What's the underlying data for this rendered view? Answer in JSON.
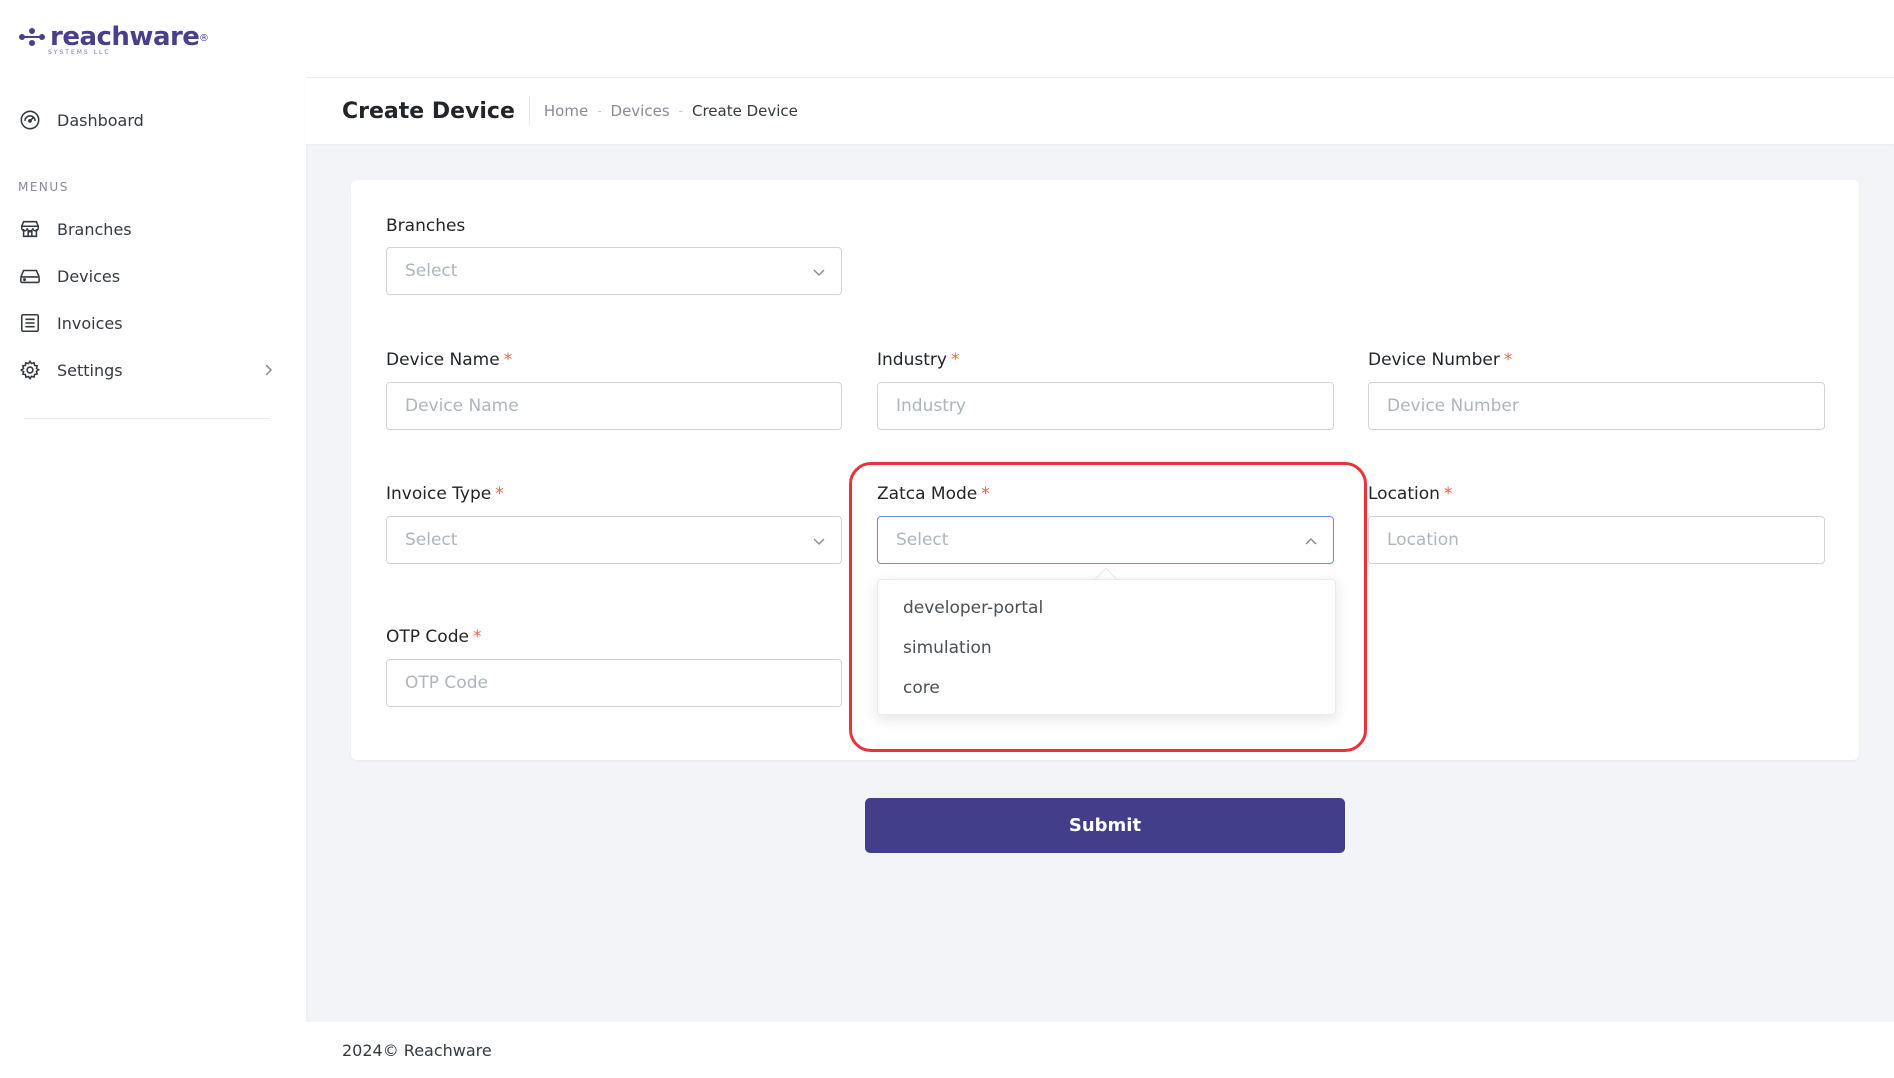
{
  "app": {
    "logo_text": "reachware",
    "logo_sub": "SYSTEMS LLC",
    "brand_color": "#433e8a"
  },
  "sidebar": {
    "dashboard": {
      "label": "Dashboard",
      "icon": "speedometer-icon"
    },
    "menus_title": "MENUS",
    "items": [
      {
        "label": "Branches",
        "icon": "store-icon"
      },
      {
        "label": "Devices",
        "icon": "hard-drive-icon"
      },
      {
        "label": "Invoices",
        "icon": "receipt-icon"
      },
      {
        "label": "Settings",
        "icon": "gear-icon"
      }
    ]
  },
  "header": {
    "page_title": "Create Device",
    "breadcrumb": [
      "Home",
      "Devices",
      "Create Device"
    ]
  },
  "form": {
    "branches": {
      "label": "Branches",
      "placeholder": "Select"
    },
    "device_name": {
      "label": "Device Name",
      "required": "*",
      "placeholder": "Device Name"
    },
    "industry": {
      "label": "Industry",
      "required": "*",
      "placeholder": "Industry"
    },
    "device_number": {
      "label": "Device Number",
      "required": "*",
      "placeholder": "Device Number"
    },
    "invoice_type": {
      "label": "Invoice Type",
      "required": "*",
      "placeholder": "Select"
    },
    "zatca_mode": {
      "label": "Zatca Mode",
      "required": "*",
      "placeholder": "Select",
      "options": [
        "developer-portal",
        "simulation",
        "core"
      ]
    },
    "location": {
      "label": "Location",
      "required": "*",
      "placeholder": "Location"
    },
    "otp_code": {
      "label": "OTP Code",
      "required": "*",
      "placeholder": "OTP Code"
    },
    "submit_label": "Submit"
  },
  "footer": {
    "text": "2024© Reachware"
  },
  "colors": {
    "required": "#f06548",
    "highlight": "#e8333c",
    "focus_border": "#6d8fd6"
  }
}
